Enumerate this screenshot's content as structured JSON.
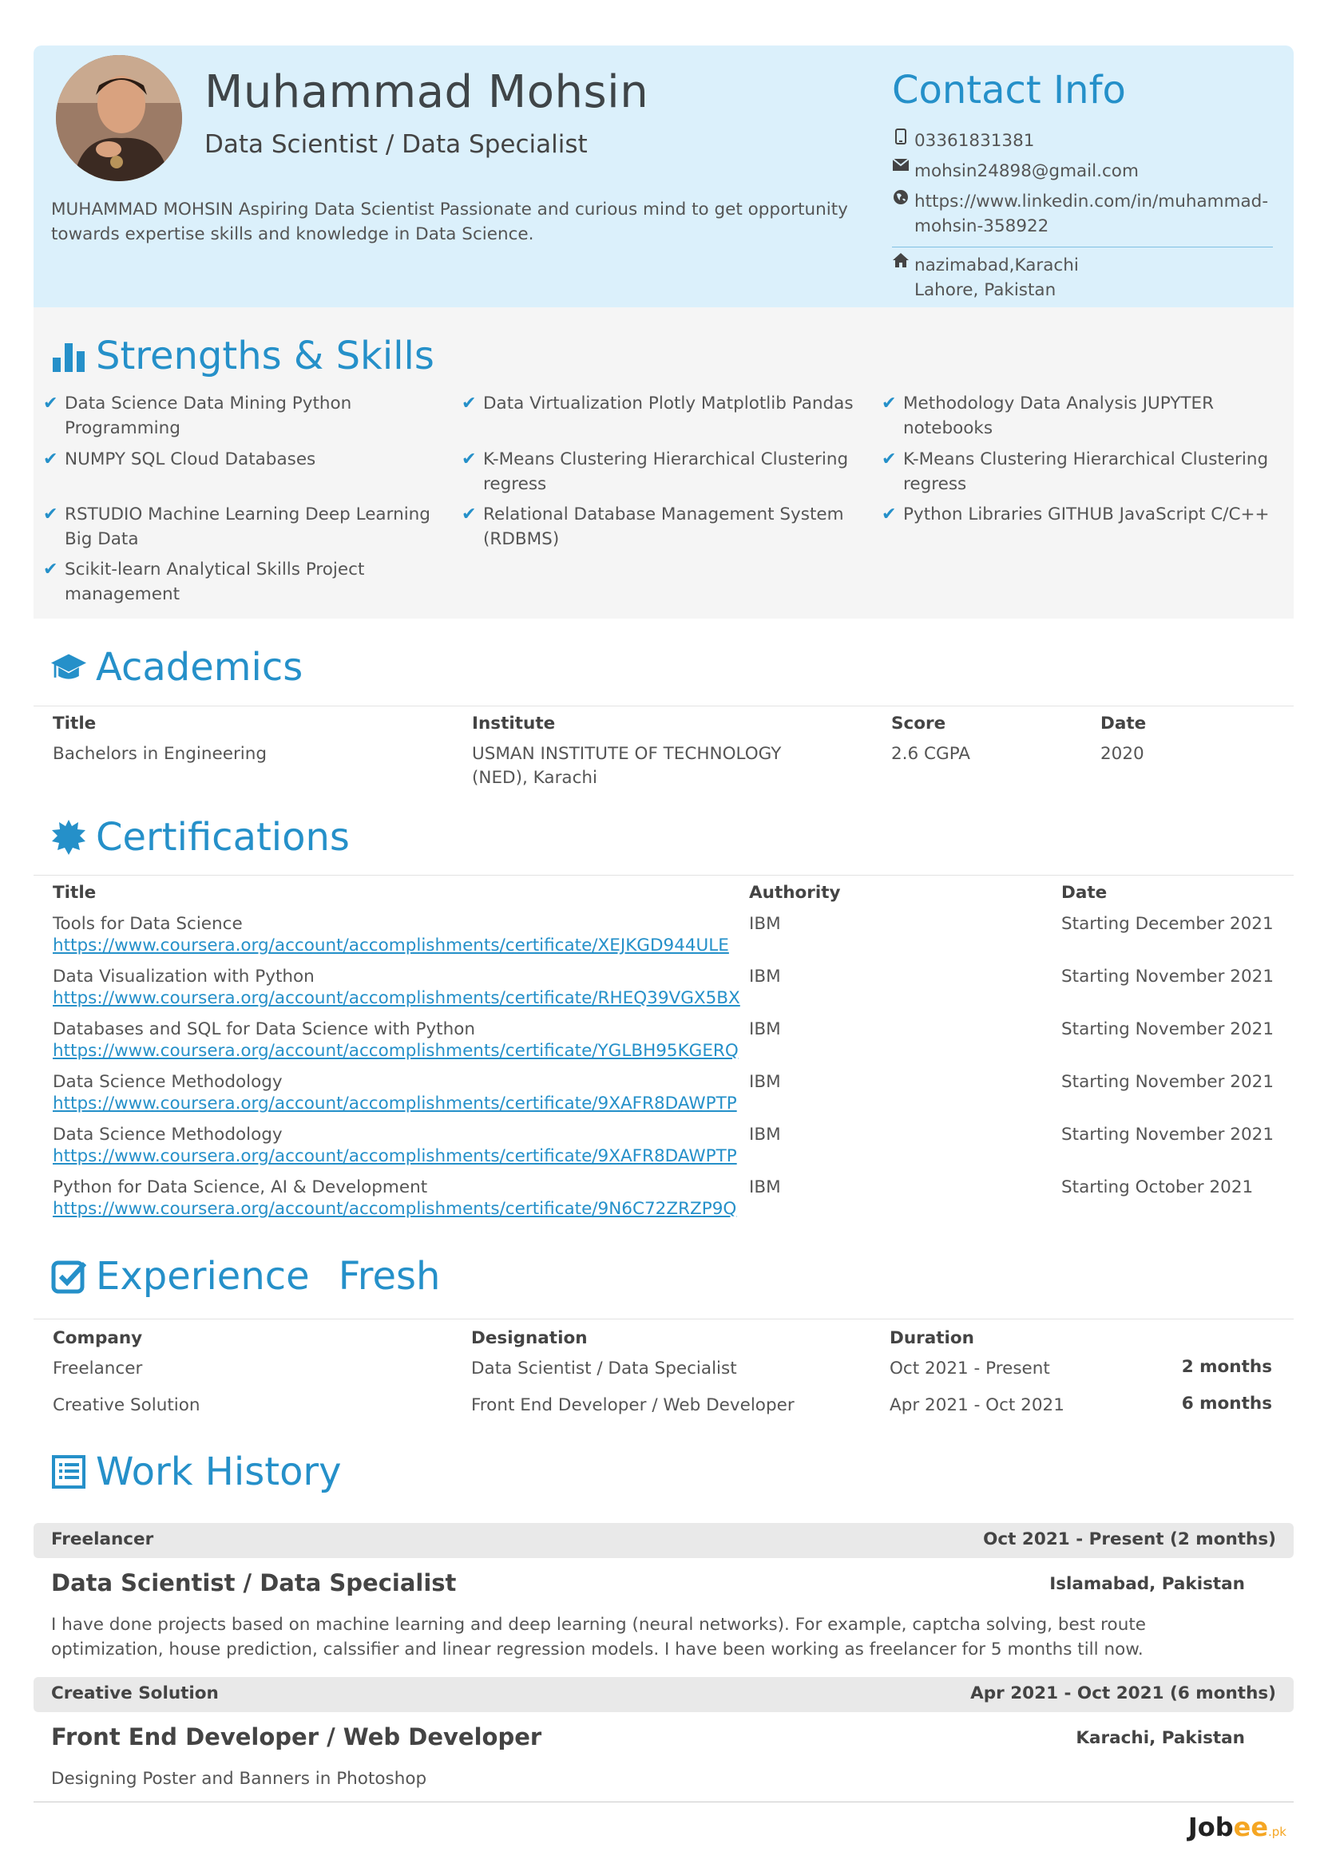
{
  "profile": {
    "name": "Muhammad Mohsin",
    "role": "Data Scientist / Data Specialist",
    "summary": "MUHAMMAD MOHSIN Aspiring Data Scientist Passionate and curious mind to get opportunity towards expertise skills and knowledge in Data Science."
  },
  "contact": {
    "title": "Contact Info",
    "phone": "03361831381",
    "email": "mohsin24898@gmail.com",
    "linkedin_line1": "https://www.linkedin.com/in/muhammad-",
    "linkedin_line2": "mohsin-358922",
    "address_line1": "nazimabad,Karachi",
    "address_line2": "Lahore, Pakistan",
    "icons": [
      "phone-icon",
      "envelope-icon",
      "globe-icon",
      "home-icon"
    ]
  },
  "skills": {
    "title": "Strengths & Skills",
    "col1": [
      "Data Science Data Mining Python Programming",
      "NUMPY SQL Cloud Databases",
      "RSTUDIO Machine Learning Deep Learning Big Data",
      "Scikit-learn Analytical Skills Project management"
    ],
    "col2": [
      "Data Virtualization Plotly Matplotlib Pandas",
      "K-Means Clustering Hierarchical Clustering regress",
      "Relational Database Management System (RDBMS)"
    ],
    "col3": [
      "Methodology Data Analysis JUPYTER notebooks",
      "K-Means Clustering Hierarchical Clustering regress",
      "Python Libraries GITHUB JavaScript C/C++"
    ]
  },
  "academics": {
    "title": "Academics",
    "headers": [
      "Title",
      "Institute",
      "Score",
      "Date"
    ],
    "rows": [
      {
        "title": "Bachelors in Engineering",
        "institute_line1": "USMAN INSTITUTE OF TECHNOLOGY",
        "institute_line2": "(NED), Karachi",
        "score": "2.6 CGPA",
        "date": "2020"
      }
    ]
  },
  "certifications": {
    "title": "Certifications",
    "headers": [
      "Title",
      "Authority",
      "Date"
    ],
    "rows": [
      {
        "title": "Tools for Data Science",
        "url": "https://www.coursera.org/account/accomplishments/certificate/XEJKGD944ULE",
        "authority": "IBM",
        "date": "Starting December 2021"
      },
      {
        "title": "Data Visualization with Python",
        "url": "https://www.coursera.org/account/accomplishments/certificate/RHEQ39VGX5BX",
        "authority": "IBM",
        "date": "Starting November 2021"
      },
      {
        "title": "Databases and SQL for Data Science with Python",
        "url": "https://www.coursera.org/account/accomplishments/certificate/YGLBH95KGERQ",
        "authority": "IBM",
        "date": "Starting November 2021"
      },
      {
        "title": "Data Science Methodology",
        "url": "https://www.coursera.org/account/accomplishments/certificate/9XAFR8DAWPTP",
        "authority": "IBM",
        "date": "Starting November 2021"
      },
      {
        "title": "Data Science Methodology",
        "url": "https://www.coursera.org/account/accomplishments/certificate/9XAFR8DAWPTP",
        "authority": "IBM",
        "date": "Starting November 2021"
      },
      {
        "title": "Python for Data Science, AI & Development",
        "url": "https://www.coursera.org/account/accomplishments/certificate/9N6C72ZRZP9Q",
        "authority": "IBM",
        "date": "Starting October 2021"
      }
    ]
  },
  "experience": {
    "title": "Experience",
    "subtitle": "Fresh",
    "headers": [
      "Company",
      "Designation",
      "Duration"
    ],
    "rows": [
      {
        "company": "Freelancer",
        "designation": "Data Scientist / Data Specialist",
        "duration": "Oct 2021 - Present",
        "length": "2 months"
      },
      {
        "company": "Creative Solution",
        "designation": "Front End Developer / Web Developer",
        "duration": "Apr 2021 - Oct 2021",
        "length": "6 months"
      }
    ]
  },
  "work_history": {
    "title": "Work History",
    "items": [
      {
        "company": "Freelancer",
        "period": "Oct 2021 - Present  (2 months)",
        "role": "Data Scientist / Data Specialist",
        "location": "Islamabad, Pakistan",
        "description": "I have done projects based on machine learning and deep learning (neural networks). For example, captcha solving, best route optimization, house prediction, calssifier and linear regression models. I have been working as freelancer for 5 months till now."
      },
      {
        "company": "Creative Solution",
        "period": "Apr 2021 - Oct 2021  (6 months)",
        "role": "Front End Developer / Web Developer",
        "location": "Karachi, Pakistan",
        "description": "Designing Poster and Banners in Photoshop"
      }
    ]
  },
  "footer": {
    "logo_main": "Job",
    "logo_accent": "ee",
    "logo_suffix": ".pk"
  },
  "colors": {
    "accent": "#2590c9",
    "header_bg": "#dbf0fb",
    "skills_bg": "#f5f5f5",
    "bar_bg": "#e9e9e9"
  }
}
